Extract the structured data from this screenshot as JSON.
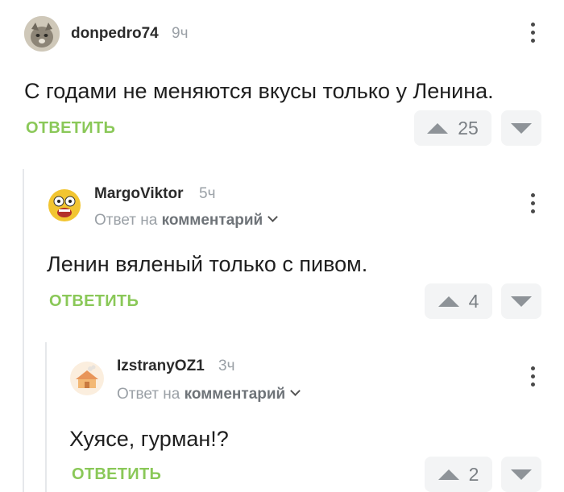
{
  "comments": [
    {
      "username": "donpedro74",
      "time": "9ч",
      "text": "С годами не меняются вкусы только у Ленина.",
      "reply_label": "ОТВЕТИТЬ",
      "votes": "25"
    },
    {
      "username": "MargoViktor",
      "time": "5ч",
      "reply_to_prefix": "Ответ на",
      "reply_to_target": "комментарий",
      "text": "Ленин вяленый только с пивом.",
      "reply_label": "ОТВЕТИТЬ",
      "votes": "4"
    },
    {
      "username": "IzstranyOZ1",
      "time": "3ч",
      "reply_to_prefix": "Ответ на",
      "reply_to_target": "комментарий",
      "text": "Хуясе, гурман!?",
      "reply_label": "ОТВЕТИТЬ",
      "votes": "2"
    }
  ],
  "colors": {
    "accent_green": "#8ac858",
    "muted_gray": "#9aa0a6",
    "vote_bg": "#f3f4f5"
  },
  "icons": [
    "kebab-menu-icon",
    "upvote-arrow-icon",
    "downvote-arrow-icon",
    "chevron-down-icon"
  ]
}
